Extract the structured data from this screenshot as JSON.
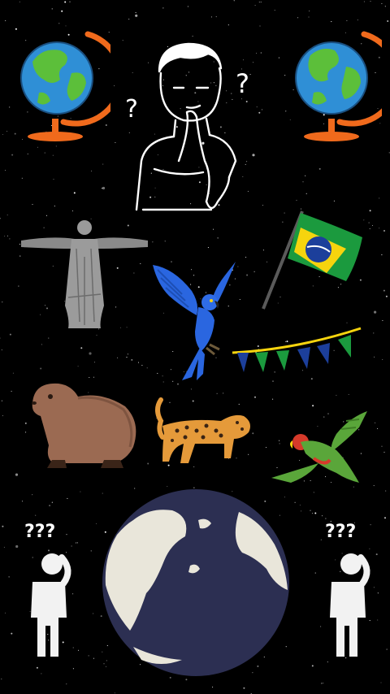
{
  "scene": {
    "background_color": "#000000",
    "star_color": "#ffffff",
    "question_mark": "?",
    "colors": {
      "globe_ocean": "#2f8fd6",
      "globe_land": "#5cbf3a",
      "globe_stand": "#f06a1c",
      "flag_green": "#1b9a3e",
      "flag_yellow": "#f6d40e",
      "flag_blue": "#1c3f9b",
      "macaw_blue": "#2a66e0",
      "capybara_brown": "#9b6a52",
      "jaguar_orange": "#e59a3a",
      "parrot_green": "#5aa63a",
      "parrot_red": "#d63a2a",
      "earth_ocean": "#2c2f52",
      "earth_land": "#e9e6da",
      "statue_gray": "#8a8a8a"
    }
  },
  "items": [
    {
      "id": "globe-left",
      "icon": "globe-icon"
    },
    {
      "id": "thinking-boy",
      "icon": "thinking-person-icon"
    },
    {
      "id": "globe-right",
      "icon": "globe-icon"
    },
    {
      "id": "christ-redeemer",
      "icon": "statue-icon"
    },
    {
      "id": "brazil-flag",
      "icon": "flag-icon"
    },
    {
      "id": "blue-macaw",
      "icon": "macaw-icon"
    },
    {
      "id": "bunting",
      "icon": "bunting-icon"
    },
    {
      "id": "capybara",
      "icon": "capybara-icon"
    },
    {
      "id": "jaguar",
      "icon": "jaguar-icon"
    },
    {
      "id": "green-parrot",
      "icon": "parrot-icon"
    },
    {
      "id": "confused-person-left",
      "icon": "confused-person-icon"
    },
    {
      "id": "earth",
      "icon": "earth-icon"
    },
    {
      "id": "confused-person-right",
      "icon": "confused-person-icon"
    }
  ]
}
